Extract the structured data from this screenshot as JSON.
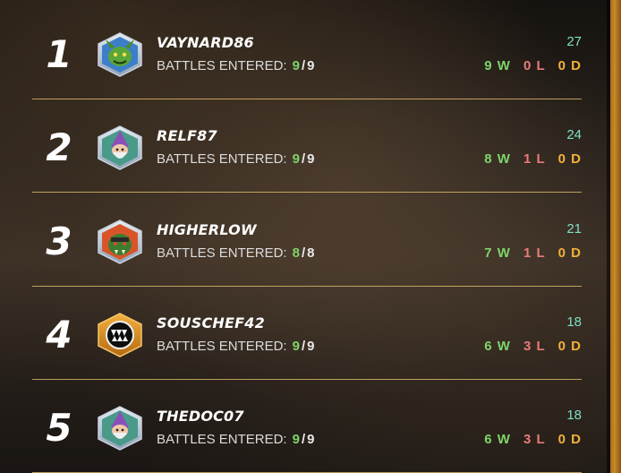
{
  "leaderboard": [
    {
      "rank": "1",
      "name": "VAYNARD86",
      "battles_label": "BATTLES ENTERED:",
      "battles_current": "9",
      "battles_total": "9",
      "score": "27",
      "wins": "9 W",
      "losses": "0 L",
      "draws": "0 D",
      "avatar": "green-goblin-avatar"
    },
    {
      "rank": "2",
      "name": "RELF87",
      "battles_label": "BATTLES ENTERED:",
      "battles_current": "9",
      "battles_total": "9",
      "score": "24",
      "wins": "8 W",
      "losses": "1 L",
      "draws": "0 D",
      "avatar": "wizard-avatar"
    },
    {
      "rank": "3",
      "name": "HIGHERLOW",
      "battles_label": "BATTLES ENTERED:",
      "battles_current": "8",
      "battles_total": "8",
      "score": "21",
      "wins": "7 W",
      "losses": "1 L",
      "draws": "0 D",
      "avatar": "orc-avatar"
    },
    {
      "rank": "4",
      "name": "SOUSCHEF42",
      "battles_label": "BATTLES ENTERED:",
      "battles_current": "9",
      "battles_total": "9",
      "score": "18",
      "wins": "6 W",
      "losses": "3 L",
      "draws": "0 D",
      "avatar": "monster-mouth-avatar"
    },
    {
      "rank": "5",
      "name": "THEDOC07",
      "battles_label": "BATTLES ENTERED:",
      "battles_current": "9",
      "battles_total": "9",
      "score": "18",
      "wins": "6 W",
      "losses": "3 L",
      "draws": "0 D",
      "avatar": "wizard-avatar"
    }
  ],
  "colors": {
    "wins": "#7fd36a",
    "losses": "#ea7a7a",
    "draws": "#f2b23a",
    "score": "#7fe0c4",
    "separator": "#d9b46a",
    "side_bar": "#c98a2a"
  }
}
